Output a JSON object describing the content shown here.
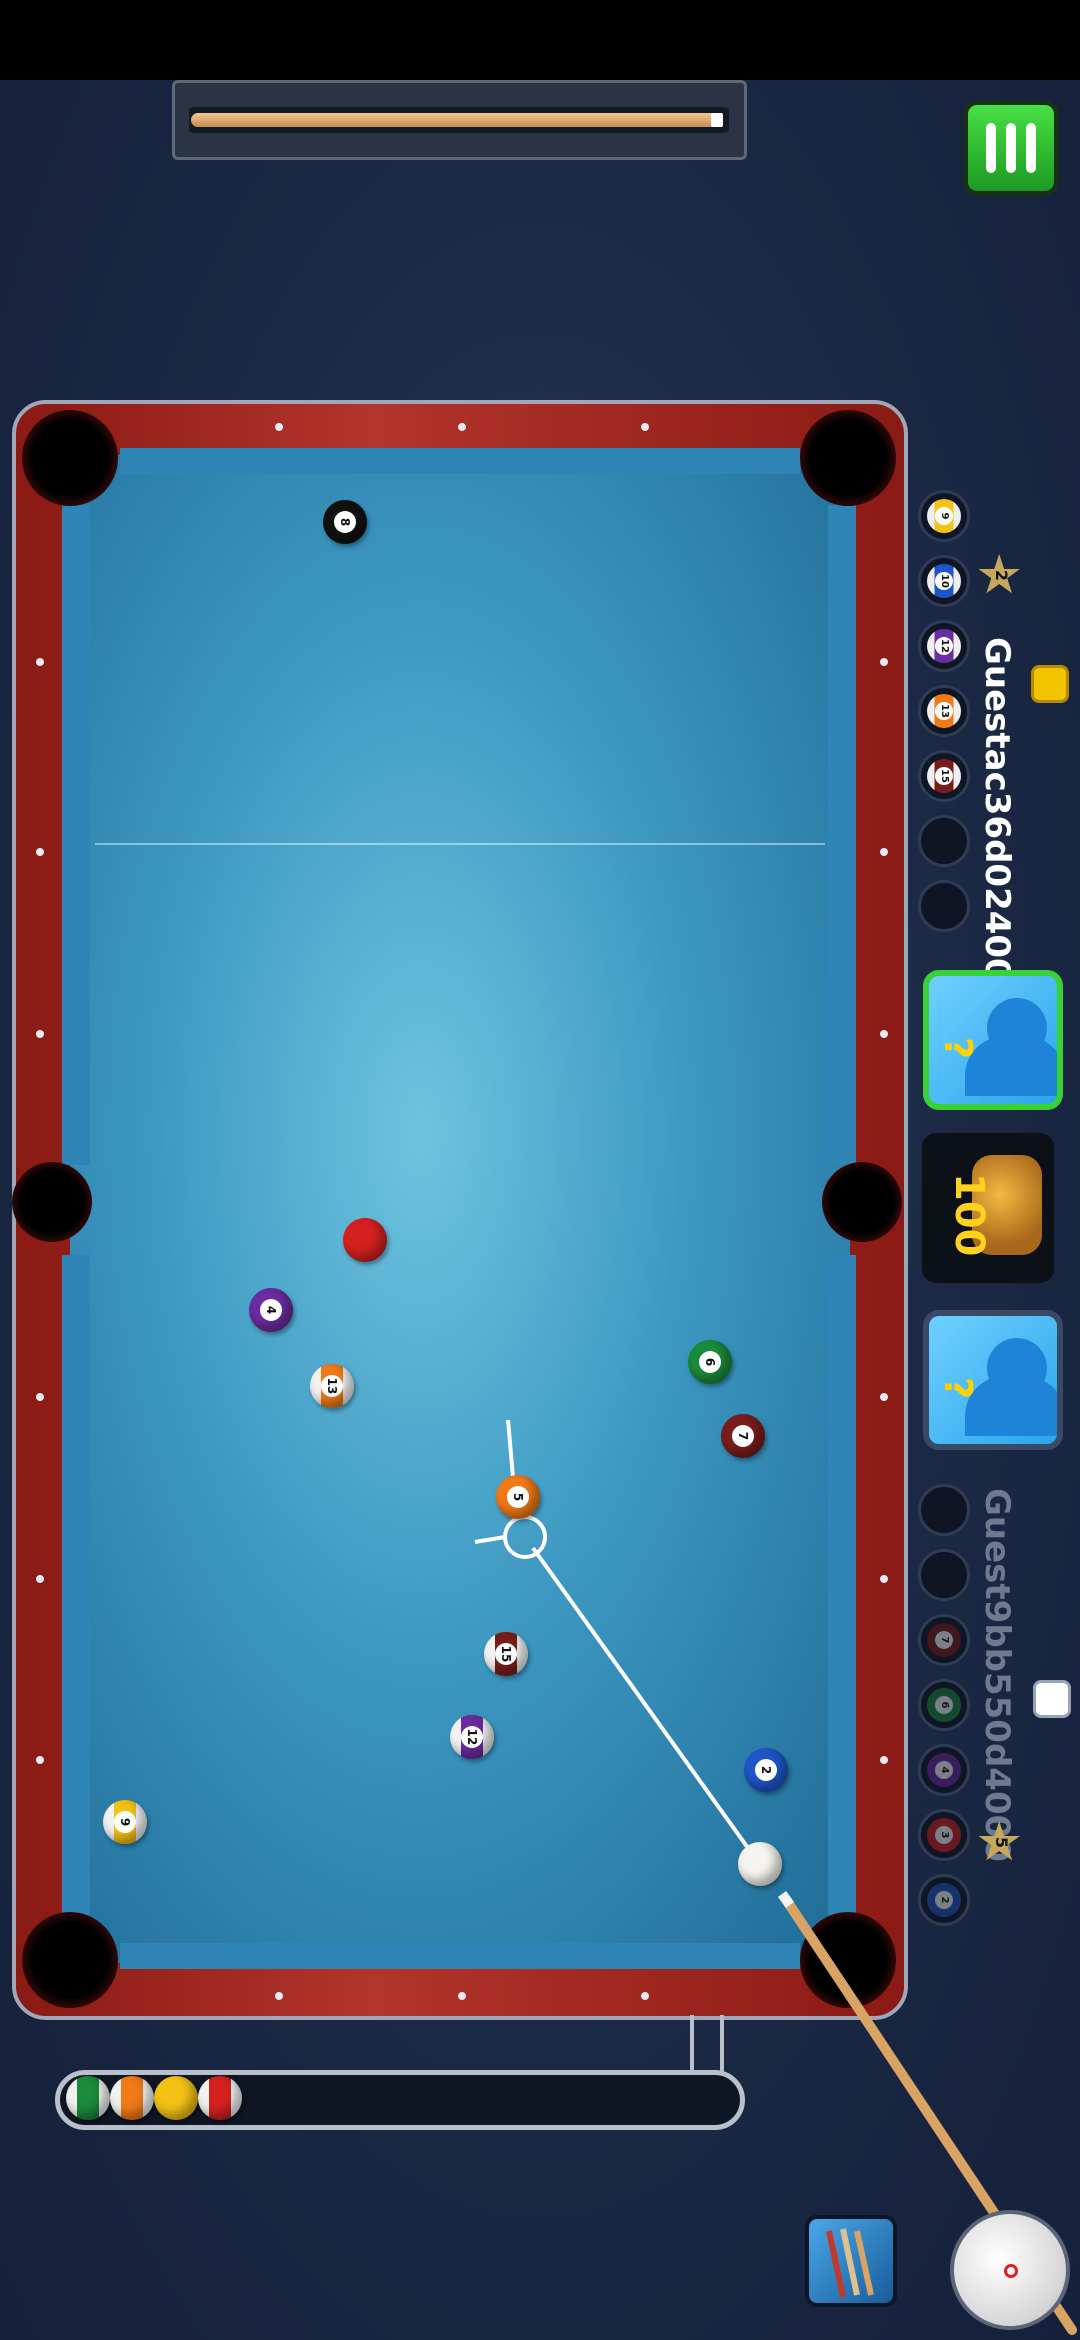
{
  "players": {
    "left": {
      "name": "Guest9bb550d4000",
      "level": "5"
    },
    "right": {
      "name": "Guestac36d024000",
      "level": "2"
    }
  },
  "bet": {
    "amount": "100"
  },
  "left_rack": [
    "",
    "",
    "7",
    "6",
    "4",
    "3",
    "2"
  ],
  "right_rack": [
    "9",
    "10",
    "12",
    "13",
    "15",
    "",
    ""
  ],
  "rack_colors": {
    "1": "#f3c214",
    "2": "#1f55c9",
    "3": "#d4211f",
    "4": "#6a2ca0",
    "5": "#f07a16",
    "6": "#1b8a3c",
    "7": "#7a1d1a",
    "8": "#111111",
    "9": "#f3c214",
    "10": "#1f55c9",
    "11": "#d4211f",
    "12": "#6a2ca0",
    "13": "#f07a16",
    "14": "#1b8a3c",
    "15": "#7a1d1a"
  },
  "balls_on_table": [
    {
      "n": "8"
    },
    {
      "n": "3"
    },
    {
      "n": "4"
    },
    {
      "n": "13"
    },
    {
      "n": "6"
    },
    {
      "n": "7"
    },
    {
      "n": "5"
    },
    {
      "n": "15"
    },
    {
      "n": "12"
    },
    {
      "n": "2"
    },
    {
      "n": "9"
    },
    {
      "n": "cue"
    }
  ],
  "pocketed": [
    "14",
    "13",
    "1",
    "11"
  ],
  "icons": [
    "menu-icon",
    "chat-icon",
    "cue-icon",
    "spin-icon",
    "avatar-icon",
    "coins-icon",
    "star-icon"
  ]
}
